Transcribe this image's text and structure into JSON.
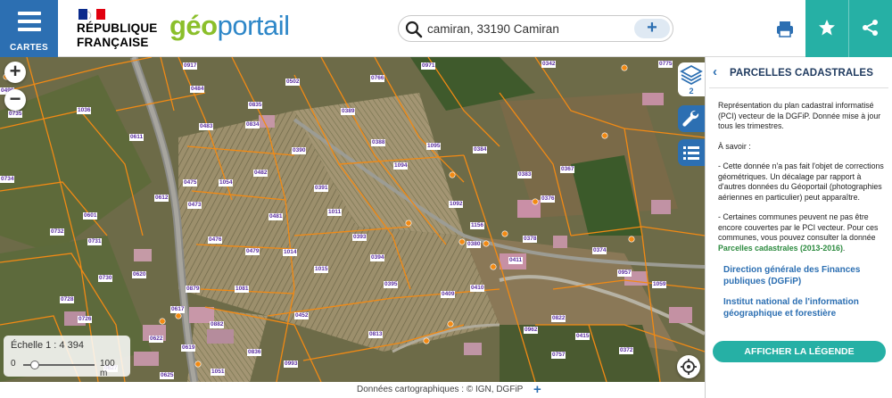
{
  "header": {
    "menu_label": "CARTES",
    "republique_line1": "RÉPUBLIQUE",
    "republique_line2": "FRANÇAISE",
    "logo_geo": "géo",
    "logo_portail": "portail",
    "search_value": "camiran, 33190 Camiran",
    "colors": {
      "primary": "#2c6fb2",
      "accent": "#26b0a5",
      "logo_green": "#8bbf2b"
    },
    "icons": [
      "hamburger-icon",
      "flag-icon",
      "search-icon",
      "plus-icon",
      "print-icon",
      "star-icon",
      "share-icon"
    ]
  },
  "map": {
    "zoom_in": "+",
    "zoom_out": "−",
    "layers_count": "2",
    "scale_label": "Échelle 1 : 4 394",
    "scale_min": "0",
    "scale_max": "100 m",
    "parcel_color": "#f28a14",
    "parcel_labels": [
      "0917",
      "0971",
      "0342",
      "0499",
      "0484",
      "0502",
      "0766",
      "0775",
      "0735",
      "1036",
      "0835",
      "0389",
      "0483",
      "0834",
      "0388",
      "1095",
      "0384",
      "0383",
      "0611",
      "0390",
      "1094",
      "0367",
      "0475",
      "1054",
      "0482",
      "0391",
      "0612",
      "1092",
      "0376",
      "0734",
      "0473",
      "1011",
      "0601",
      "0481",
      "1156",
      "0732",
      "0476",
      "0393",
      "0380",
      "0378",
      "0731",
      "0479",
      "1014",
      "0394",
      "0411",
      "0374",
      "0620",
      "1015",
      "0395",
      "0730",
      "0879",
      "1081",
      "0409",
      "0410",
      "0728",
      "0726",
      "0617",
      "0882",
      "0452",
      "0622",
      "0619",
      "0836",
      "0993",
      "0962",
      "0625",
      "1051",
      "0627",
      "0813",
      "0822",
      "0957",
      "1059",
      "0372",
      "0415",
      "0757"
    ]
  },
  "footer": {
    "credits": "Données cartographiques : ©   IGN,  DGFiP",
    "plus": "+"
  },
  "panel": {
    "back_icon": "chevron-left-icon",
    "title": "PARCELLES CADASTRALES",
    "description_1": "Représentation du plan cadastral informatisé (PCI) vecteur de la DGFiP. Donnée mise à jour tous les trimestres.",
    "description_2": "À savoir :",
    "description_3": "- Cette donnée n'a pas fait l'objet de corrections géométriques. Un décalage par rapport à d'autres données du Géoportail (photographies aériennes en particulier) peut apparaître.",
    "description_4_pre": "- Certaines communes peuvent ne pas être encore couvertes par le PCI vecteur. Pour ces communes, vous pouvez consulter la donnée",
    "description_4_link": "Parcelles cadastrales (2013-2016)",
    "description_4_post": ".",
    "org_1": "Direction générale des Finances publiques (DGFiP)",
    "org_2": "Institut national de l'information géographique et forestière",
    "legend_button": "AFFICHER LA LÉGENDE"
  }
}
